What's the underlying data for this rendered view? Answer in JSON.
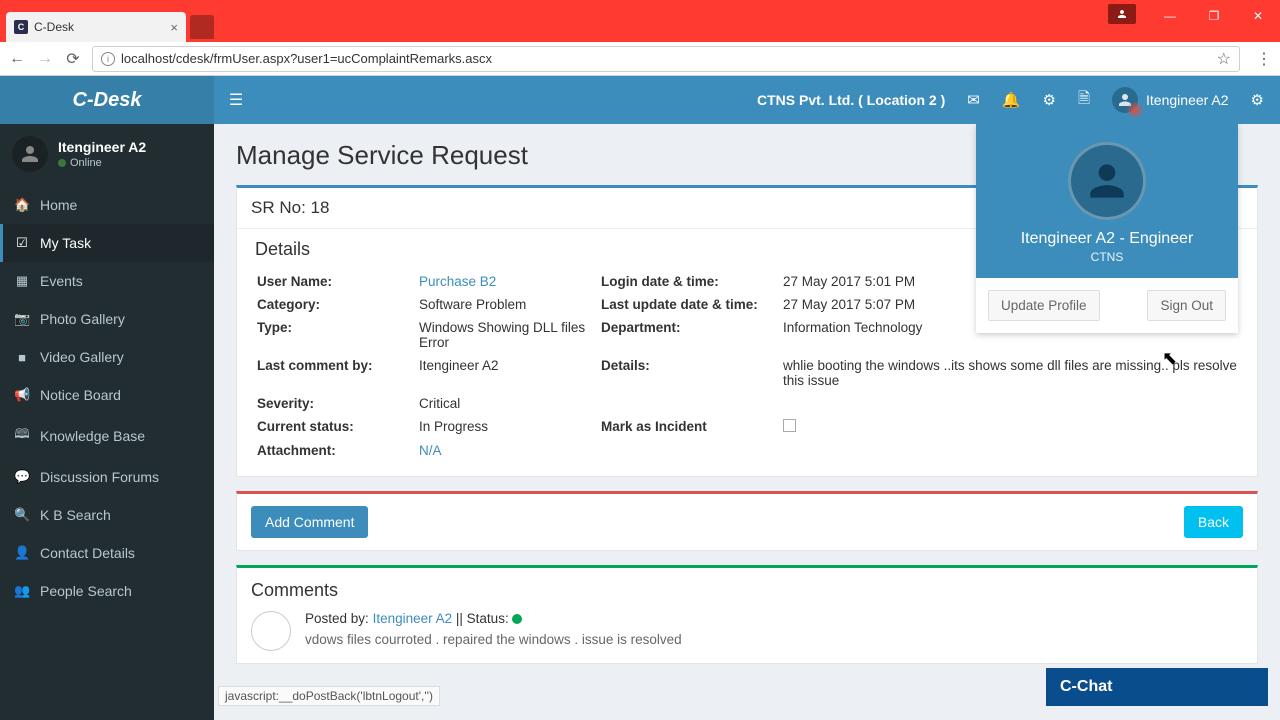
{
  "browser": {
    "tab_title": "C-Desk",
    "url": "localhost/cdesk/frmUser.aspx?user1=ucComplaintRemarks.ascx",
    "status_text": "javascript:__doPostBack('lbtnLogout','')"
  },
  "app": {
    "logo": "C-Desk",
    "org": "CTNS Pvt. Ltd. ( Location 2 )",
    "header_user": "Itengineer A2"
  },
  "side_user": {
    "name": "Itengineer A2",
    "status": "Online"
  },
  "menu": [
    {
      "icon": "🏠",
      "label": "Home"
    },
    {
      "icon": "☑",
      "label": "My Task"
    },
    {
      "icon": "▦",
      "label": "Events"
    },
    {
      "icon": "📷",
      "label": "Photo Gallery"
    },
    {
      "icon": "■",
      "label": "Video Gallery"
    },
    {
      "icon": "📢",
      "label": "Notice Board"
    },
    {
      "icon": "🕮",
      "label": "Knowledge Base"
    },
    {
      "icon": "💬",
      "label": "Discussion Forums"
    },
    {
      "icon": "🔍",
      "label": "K B Search"
    },
    {
      "icon": "👤",
      "label": "Contact Details"
    },
    {
      "icon": "👥",
      "label": "People Search"
    }
  ],
  "page": {
    "title": "Manage Service Request",
    "sr_label": "SR No: 18",
    "details_label": "Details",
    "fields": {
      "user_name_lbl": "User Name:",
      "user_name_val": "Purchase B2",
      "login_lbl": "Login date & time:",
      "login_val": "27 May 2017 5:01 PM",
      "category_lbl": "Category:",
      "category_val": "Software Problem",
      "update_lbl": "Last update date & time:",
      "update_val": "27 May 2017 5:07 PM",
      "type_lbl": "Type:",
      "type_val": "Windows Showing DLL files Error",
      "dept_lbl": "Department:",
      "dept_val": "Information Technology",
      "lastc_lbl": "Last comment by:",
      "lastc_val": "Itengineer A2",
      "details_lbl": "Details:",
      "details_val": "whlie booting the windows ..its shows some dll files are missing.. pls resolve this issue",
      "severity_lbl": "Severity:",
      "severity_val": "Critical",
      "status_lbl": "Current status:",
      "status_val": "In Progress",
      "incident_lbl": "Mark as Incident",
      "attach_lbl": "Attachment:",
      "attach_val": "N/A"
    },
    "add_comment": "Add Comment",
    "back": "Back",
    "comments_label": "Comments",
    "posted_by_lbl": "Posted by:",
    "posted_by_val": "Itengineer A2",
    "status_sep": " || Status: ",
    "comment_preview": "vdows files courroted . repaired the windows . issue is resolved"
  },
  "user_dd": {
    "name": "Itengineer A2 - Engineer",
    "org": "CTNS",
    "update": "Update Profile",
    "signout": "Sign Out"
  },
  "chat": {
    "label": "C-Chat"
  }
}
